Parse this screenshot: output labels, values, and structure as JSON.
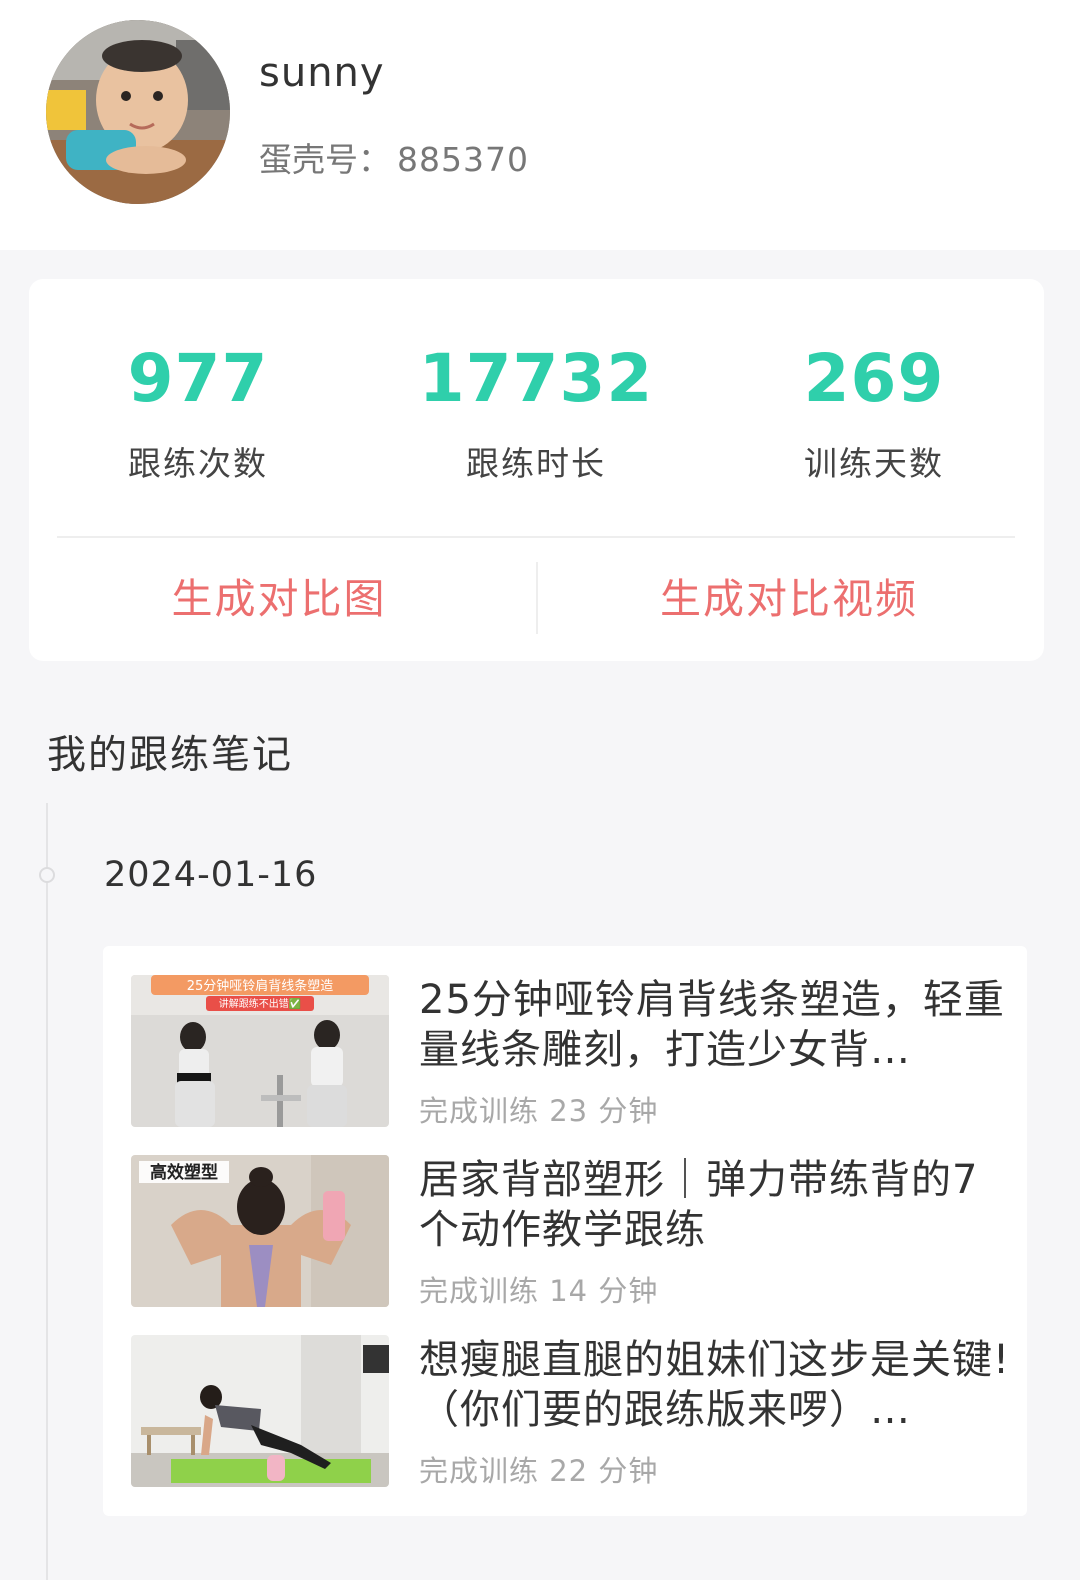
{
  "profile": {
    "username": "sunny",
    "account_label": "蛋壳号：",
    "account_id": "885370"
  },
  "stats": {
    "items": [
      {
        "value": "977",
        "label": "跟练次数"
      },
      {
        "value": "17732",
        "label": "跟练时长"
      },
      {
        "value": "269",
        "label": "训练天数"
      }
    ],
    "accent_color": "#2fcfab"
  },
  "actions": {
    "compare_image": "生成对比图",
    "compare_video": "生成对比视频",
    "color": "#ec6f6f"
  },
  "notes": {
    "section_title": "我的跟练笔记",
    "date": "2024-01-16",
    "items": [
      {
        "title": "25分钟哑铃肩背线条塑造，轻重量线条雕刻，打造少女背…",
        "meta": "完成训练 23 分钟",
        "thumb_caption": "25分钟哑铃肩背线条塑造",
        "thumb_subcaption": "讲解跟练不出错✅"
      },
      {
        "title": "居家背部塑形｜弹力带练背的7个动作教学跟练",
        "meta": "完成训练 14 分钟",
        "thumb_caption": "高效塑型"
      },
      {
        "title": "想瘦腿直腿的姐妹们这步是关键!（你们要的跟练版来啰）…",
        "meta": "完成训练 22 分钟"
      }
    ]
  }
}
